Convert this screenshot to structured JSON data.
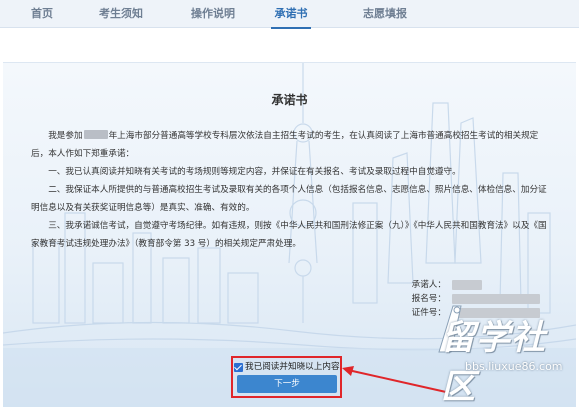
{
  "nav": {
    "items": [
      {
        "label": "首页"
      },
      {
        "label": "考生须知"
      },
      {
        "label": "操作说明"
      },
      {
        "label": "承诺书"
      },
      {
        "label": "志愿填报"
      }
    ],
    "active": "承诺书"
  },
  "pledge": {
    "title": "承诺书",
    "intro_pre": "我是参加",
    "intro_post": "年上海市部分普通高等学校专科层次依法自主招生考试的考生，在认真阅读了上海市普通高校招生考试的相关规定后，本人作如下郑重承诺：",
    "item1": "一、我已认真阅读并知晓有关考试的考场规则等规定内容，并保证在有关报名、考试及录取过程中自觉遵守。",
    "item2": "二、我保证本人所提供的与普通高校招生考试及录取有关的各项个人信息（包括报名信息、志愿信息、照片信息、体检信息、加分证明信息以及有关获奖证明信息等）是真实、准确、有效的。",
    "item3": "三、我承诺诚信考试，自觉遵守考场纪律。如有违规，则按《中华人民共和国刑法修正案（九）》《中华人民共和国教育法》以及《国家教育考试违规处理办法》（教育部令第 33 号）的相关规定严肃处理。"
  },
  "signature": {
    "pledger_label": "承诺人：",
    "reg_no_label": "报名号：",
    "id_no_label": "证件号："
  },
  "agree": {
    "checked": true,
    "label": "我已阅读并知晓以上内容"
  },
  "next_button": {
    "label": "下一步"
  },
  "watermark": {
    "text": "留学社区",
    "url": "bbs.liuxue86.com"
  },
  "colors": {
    "accent": "#2f6fb3",
    "button": "#3c86cf",
    "highlight": "#e0262a"
  }
}
